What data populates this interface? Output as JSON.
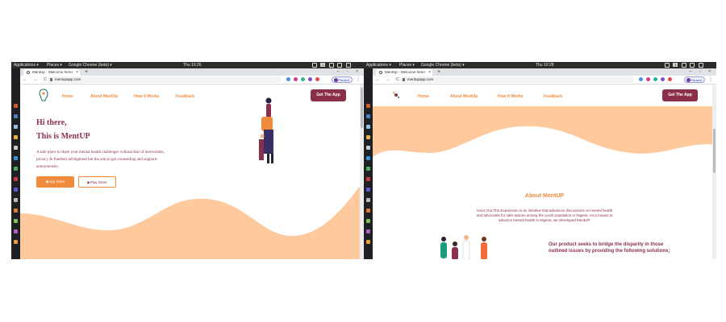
{
  "desktop": {
    "applications": "Applications ▾",
    "places": "Places ▾",
    "chrome_menu": "Google Chrome (beta) ▾",
    "clock_left": "Thu 10:26",
    "clock_right": "Thu 10:28",
    "workspace": "1"
  },
  "browser": {
    "tab_title": "MentUp - Welcome here!",
    "new_tab": "+",
    "tab_close": "×",
    "window_controls": "–  ▫  ×",
    "nav_controls": "←  →  C",
    "url": "mentupapp.com",
    "profile_status": "Paused",
    "menu": "⋮"
  },
  "site": {
    "nav": [
      "Home",
      "About MentUp",
      "How It Works",
      "Feedback"
    ],
    "cta": "Get The App",
    "hero_line1": "Hi there,",
    "hero_line2": "This is MentUP",
    "hero_text": "A safe place to share your mental health challenges without fear of insecurities, privacy & freedom infringment but the aim to get counselling and supports anonymously.",
    "button_primary": "App Store",
    "button_secondary": "Play Store",
    "about_title": "About MentUP",
    "about_text": "Voice Out The Expression is an initiative that advances discussions on mental health and advocates for safe spaces among the youth population in Nigeria. As a means to advance mental health in Nigeria, we developed MentUP.",
    "product_text": "Our product seeks to bridge the disparity in those outlined issues by providing the following solutions;"
  },
  "colors": {
    "brand_maroon": "#8c2f4b",
    "brand_orange": "#f08a3c",
    "peach": "#ffc99e"
  }
}
